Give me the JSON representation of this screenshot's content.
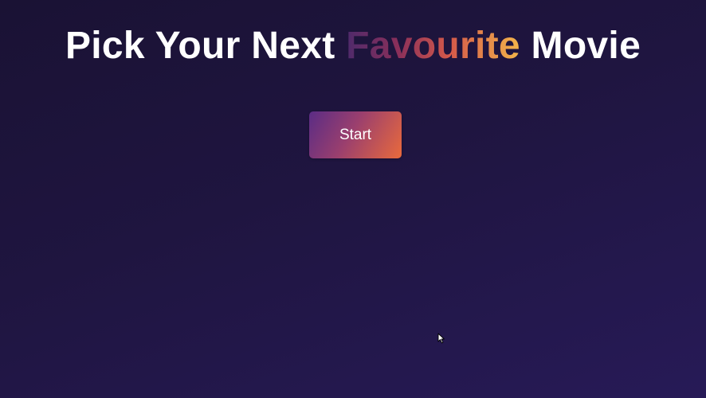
{
  "header": {
    "title_prefix": "Pick Your Next",
    "title_highlight": "Favourite",
    "title_suffix": "Movie"
  },
  "actions": {
    "start_label": "Start"
  },
  "theme": {
    "background_dark": "#1a1234",
    "background_light": "#271a57",
    "accent_start": "#5a2c85",
    "accent_end": "#e96a3c",
    "highlight_end": "#f3b54a"
  },
  "icons": {
    "cursor": "mouse-pointer-icon"
  }
}
